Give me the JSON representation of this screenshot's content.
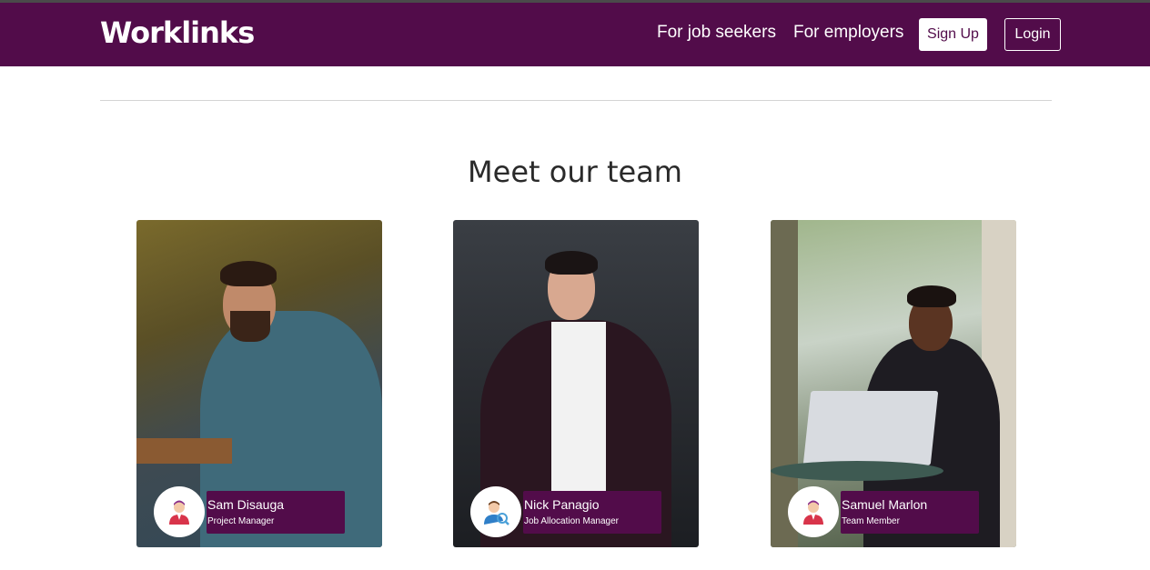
{
  "header": {
    "logo": "Worklinks",
    "nav": {
      "job_seekers": "For job seekers",
      "employers": "For employers"
    },
    "signup_label": "Sign Up",
    "login_label": "Login"
  },
  "team": {
    "title": "Meet our team",
    "members": [
      {
        "name": "Sam Disauga",
        "role": "Project Manager",
        "avatar_icon": "businessman-icon"
      },
      {
        "name": "Nick Panagio",
        "role": "Job Allocation Manager",
        "avatar_icon": "user-search-icon"
      },
      {
        "name": "Samuel Marlon",
        "role": "Team Member",
        "avatar_icon": "businessman-icon"
      }
    ]
  },
  "colors": {
    "brand": "#520c4a",
    "avatar_red": "#d8344a",
    "avatar_purple": "#8a2f8a"
  }
}
